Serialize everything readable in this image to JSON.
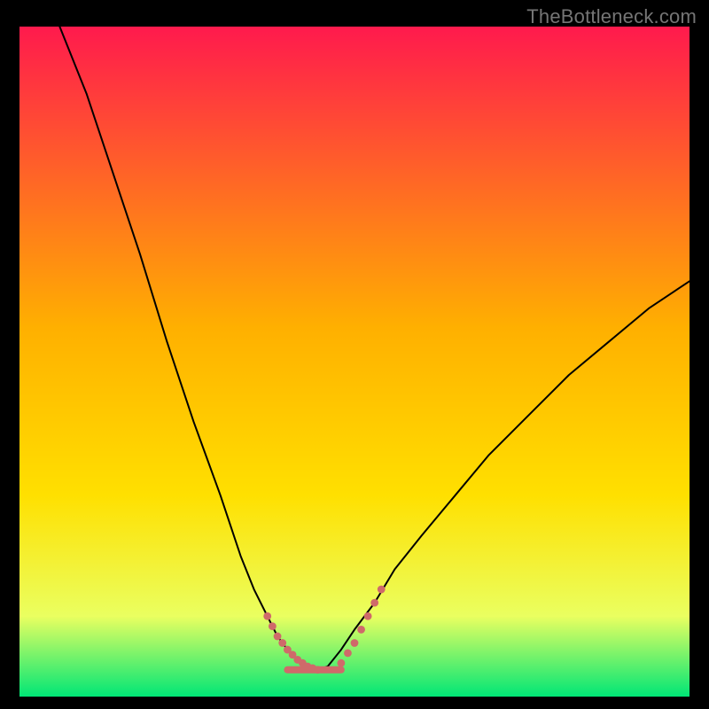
{
  "watermark": "TheBottleneck.com",
  "chart_data": {
    "type": "line",
    "title": "",
    "xlabel": "",
    "ylabel": "",
    "xlim": [
      0,
      100
    ],
    "ylim": [
      0,
      100
    ],
    "grid": false,
    "legend": false,
    "gradient_background": {
      "direction": "vertical",
      "top_color": "#ff1a4d",
      "middle_color": "#ffd000",
      "bottom_color": "#00e676"
    },
    "series": [
      {
        "name": "left_curve",
        "stroke": "#000000",
        "stroke_width": 2,
        "x": [
          6,
          10,
          14,
          18,
          22,
          26,
          30,
          33,
          35,
          37,
          38.5,
          40,
          41.5,
          43,
          44.5
        ],
        "y": [
          100,
          90,
          78,
          66,
          53,
          41,
          30,
          21,
          16,
          12,
          9,
          7,
          5.5,
          4.5,
          4
        ]
      },
      {
        "name": "right_curve",
        "stroke": "#000000",
        "stroke_width": 2,
        "x": [
          44.5,
          46,
          48,
          50,
          53,
          56,
          60,
          65,
          70,
          76,
          82,
          88,
          94,
          100
        ],
        "y": [
          4,
          4.5,
          7,
          10,
          14,
          19,
          24,
          30,
          36,
          42,
          48,
          53,
          58,
          62
        ]
      },
      {
        "name": "overlay_left",
        "stroke": "#cf6a6a",
        "stroke_width": 8,
        "dotted": true,
        "x": [
          37,
          38.5,
          40,
          41.5,
          43,
          44.5
        ],
        "y": [
          12,
          9,
          7,
          5.5,
          4.5,
          4
        ]
      },
      {
        "name": "overlay_bottom",
        "stroke": "#cf6a6a",
        "stroke_width": 8,
        "dotted": false,
        "x": [
          40,
          48
        ],
        "y": [
          4,
          4
        ]
      },
      {
        "name": "overlay_right",
        "stroke": "#cf6a6a",
        "stroke_width": 8,
        "dotted": true,
        "x": [
          48,
          50,
          52,
          54
        ],
        "y": [
          5,
          8,
          12,
          16
        ]
      }
    ]
  }
}
